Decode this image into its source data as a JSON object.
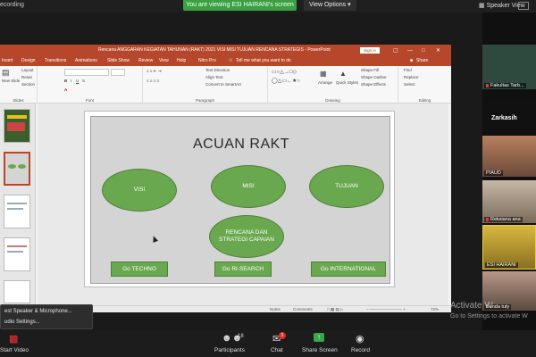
{
  "zoom": {
    "recording_label": "ecording",
    "viewing_banner": "You are viewing ESI HAIRANI's screen",
    "view_options": "View Options",
    "speaker_view": "Speaker View",
    "bottom_bar": {
      "start_video": "Start Video",
      "participants_label": "Participants",
      "participants_count": "18",
      "chat_label": "Chat",
      "chat_badge": "5",
      "share_label": "Share Screen",
      "record_label": "Record"
    },
    "popup_menu": {
      "item1": "est Speaker & Microphone...",
      "item2": "udio Settings..."
    },
    "participants": [
      {
        "name": "Fakultas Tarb...",
        "muted": true
      },
      {
        "name": "Zarkasih",
        "muted": false
      },
      {
        "name": "PIAUD",
        "muted": false
      },
      {
        "name": "Reksiana ana",
        "muted": true
      },
      {
        "name": "ESI HAIRANI",
        "muted": false
      },
      {
        "name": "Bunda tuty",
        "muted": false
      }
    ],
    "watermark_line1": "Activate W",
    "watermark_line2": "Go to Settings to activate W",
    "colors": {
      "green": "#3aa040",
      "share_green": "#39a84a",
      "badge_red": "#e02828"
    }
  },
  "powerpoint": {
    "window_title": "Rencana ANGGARAN KEGIATAN TAHUNAN (RAKT) 2021 VISI MISI TUJUAN RENCANA STRATEGIS - PowerPoint",
    "sign_in": "Sign in",
    "tabs": [
      "Insert",
      "Design",
      "Transitions",
      "Animations",
      "Slide Show",
      "Review",
      "View",
      "Help",
      "Nitro Pro",
      "Tell me what you want to do"
    ],
    "share": "Share",
    "ribbon": {
      "layout": "Layout",
      "reset": "Reset",
      "section": "Section",
      "new_slide": "New Slide",
      "slides_group": "Slides",
      "font_group": "Font",
      "paragraph_group": "Paragraph",
      "drawing_group": "Drawing",
      "editing_group": "Editing",
      "text_direction": "Text Direction",
      "align_text": "Align Text",
      "convert_smartart": "Convert to SmartArt",
      "arrange": "Arrange",
      "quick_styles": "Quick Styles",
      "shape_fill": "Shape Fill",
      "shape_outline": "Shape Outline",
      "shape_effects": "Shape Effects",
      "find": "Find",
      "replace": "Replace",
      "select": "Select"
    },
    "thumb_numbers": [
      "",
      "",
      "",
      "",
      ""
    ],
    "status": {
      "notes": "Notes",
      "comments": "Comments",
      "zoom": "72%"
    },
    "slide": {
      "title": "ACUAN RAKT",
      "ovals": [
        "VISI",
        "MISI",
        "TUJUAN",
        "RENCANA DAN STRATEGI CAPAIAN"
      ],
      "buttons": [
        "Go TECHNO",
        "Go  RI-SEARCH",
        "Go  INTERNATIONAL"
      ],
      "colors": {
        "oval_fill": "#6aa84f",
        "background": "#d4d4d4"
      }
    }
  }
}
